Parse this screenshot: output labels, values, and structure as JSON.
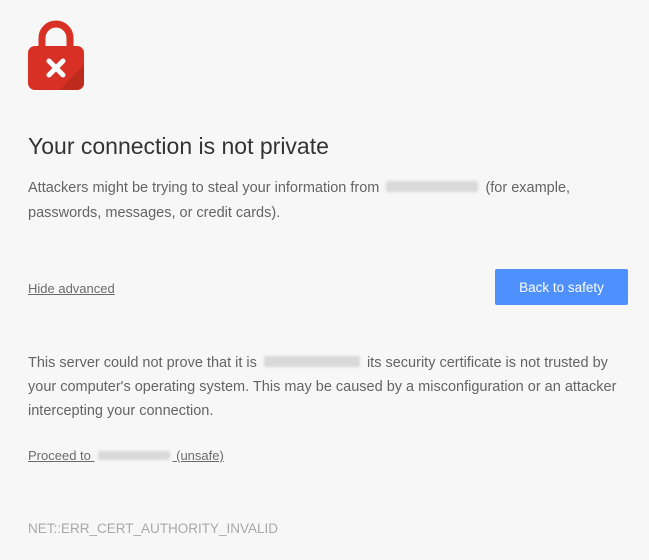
{
  "icon": {
    "name": "lock-error-icon",
    "color": "#d93025",
    "symbol_color": "#ffffff"
  },
  "title": "Your connection is not private",
  "intro": {
    "before": "Attackers might be trying to steal your information from",
    "after": "(for example, passwords, messages, or credit cards)."
  },
  "actions": {
    "hide_advanced": "Hide advanced",
    "back_to_safety": "Back to safety",
    "button_color": "#4d90fe"
  },
  "details": {
    "before": "This server could not prove that it is",
    "after": "its security certificate is not trusted by your computer's operating system. This may be caused by a misconfiguration or an attacker intercepting your connection."
  },
  "proceed": {
    "before": "Proceed to",
    "after": "(unsafe)"
  },
  "error_code": "NET::ERR_CERT_AUTHORITY_INVALID"
}
